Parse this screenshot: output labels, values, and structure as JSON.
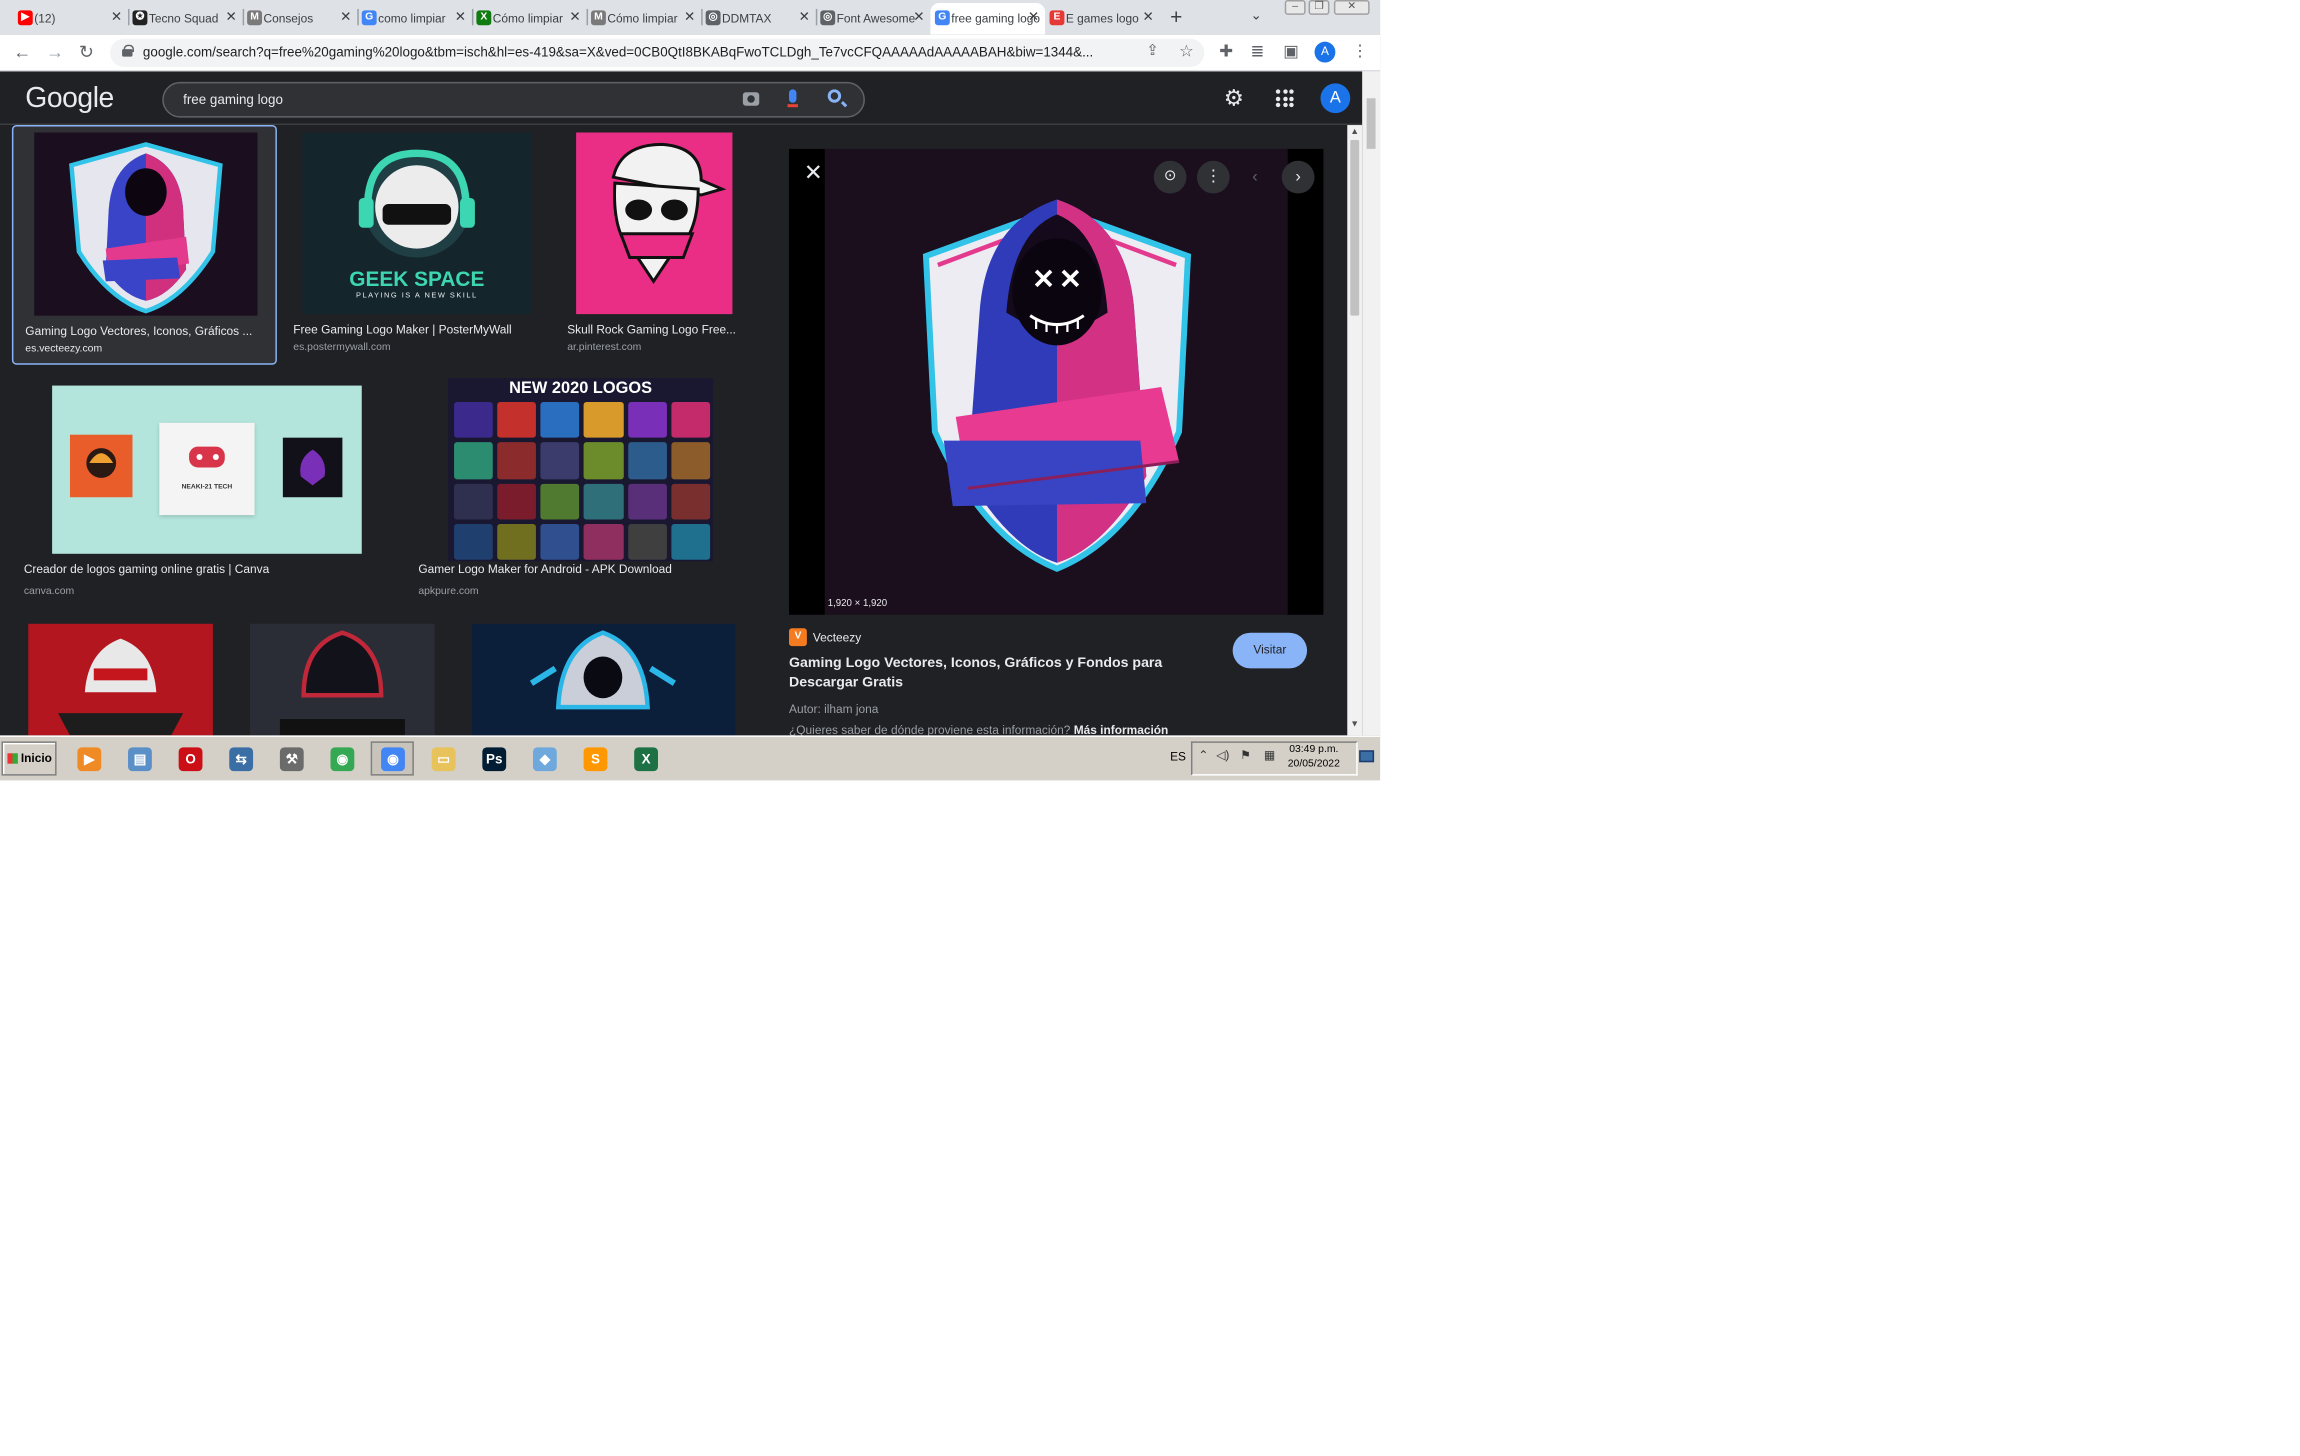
{
  "browser": {
    "tabs": [
      {
        "title": "(12)",
        "favicon": "youtube-icon",
        "color": "#ff0000",
        "glyph": "▶",
        "active": false
      },
      {
        "title": "Tecno Squad",
        "favicon": "site-icon",
        "color": "#222222",
        "glyph": "✪",
        "active": false
      },
      {
        "title": "Consejos",
        "favicon": "mc-icon",
        "color": "#7a7a7a",
        "glyph": "M",
        "active": false
      },
      {
        "title": "como limpiar",
        "favicon": "google-icon",
        "color": "#4285f4",
        "glyph": "G",
        "active": false
      },
      {
        "title": "Cómo limpiar",
        "favicon": "xbox-icon",
        "color": "#107c10",
        "glyph": "X",
        "active": false
      },
      {
        "title": "Cómo limpiar",
        "favicon": "mc-icon",
        "color": "#7a7a7a",
        "glyph": "M",
        "active": false
      },
      {
        "title": "DDMTAX",
        "favicon": "globe-icon",
        "color": "#5f6368",
        "glyph": "◎",
        "active": false
      },
      {
        "title": "Font Awesome",
        "favicon": "globe-icon",
        "color": "#5f6368",
        "glyph": "◎",
        "active": false
      },
      {
        "title": "free gaming logo",
        "favicon": "google-icon",
        "color": "#4285f4",
        "glyph": "G",
        "active": true
      },
      {
        "title": "E games logo",
        "favicon": "site-icon",
        "color": "#e53935",
        "glyph": "E",
        "active": false
      }
    ],
    "url": "google.com/search?q=free%20gaming%20logo&tbm=isch&hl=es-419&sa=X&ved=0CB0QtI8BKABqFwoTCLDgh_Te7vcCFQAAAAAdAAAAABAH&biw=1344&...",
    "profile_initial": "A"
  },
  "google": {
    "logo": "Google",
    "query": "free gaming logo",
    "avatar": "A"
  },
  "results": [
    {
      "caption": "Gaming Logo Vectores, Iconos, Gráficos ...",
      "source": "es.vecteezy.com",
      "selected": true
    },
    {
      "caption": "Free Gaming Logo Maker | PosterMyWall",
      "source": "es.postermywall.com",
      "thumb_title": "GEEK SPACE",
      "thumb_sub": "PLAYING IS A NEW SKILL"
    },
    {
      "caption": "Skull Rock Gaming Logo Free...",
      "source": "ar.pinterest.com"
    },
    {
      "caption": "Creador de logos gaming online gratis | Canva",
      "source": "canva.com",
      "thumb_tiles": [
        "",
        "NEAKI-21 TECH",
        ""
      ]
    },
    {
      "caption": "Gamer Logo Maker for Android - APK Download",
      "source": "apkpure.com",
      "thumb_title": "NEW 2020 LOGOS"
    }
  ],
  "preview": {
    "dimensions": "1,920 × 1,920",
    "site_name": "Vecteezy",
    "title": "Gaming Logo Vectores, Iconos, Gráficos y Fondos para Descargar Gratis",
    "visit_label": "Visitar",
    "author": "Autor: ilham jona",
    "question": "¿Quieres saber de dónde proviene esta información?",
    "more_info": "Más información"
  },
  "taskbar": {
    "start_label": "Inicio",
    "apps": [
      {
        "name": "media-player-icon",
        "color": "#f08a24",
        "glyph": "▶"
      },
      {
        "name": "window-icon",
        "color": "#5b8fc7",
        "glyph": "▤"
      },
      {
        "name": "opera-icon",
        "color": "#cc0f16",
        "glyph": "O"
      },
      {
        "name": "network-icon",
        "color": "#3a6ea5",
        "glyph": "⇆"
      },
      {
        "name": "tools-icon",
        "color": "#6b6b6b",
        "glyph": "⚒"
      },
      {
        "name": "chrome-icon",
        "color": "#34a853",
        "glyph": "◉"
      },
      {
        "name": "chrome-profile-icon",
        "color": "#4285f4",
        "glyph": "◉"
      },
      {
        "name": "folder-icon",
        "color": "#e8c25a",
        "glyph": "▭"
      },
      {
        "name": "photoshop-icon",
        "color": "#001d34",
        "glyph": "Ps"
      },
      {
        "name": "app-icon",
        "color": "#6fa8dc",
        "glyph": "◆"
      },
      {
        "name": "sublime-icon",
        "color": "#ff9800",
        "glyph": "S"
      },
      {
        "name": "excel-icon",
        "color": "#1e7145",
        "glyph": "X"
      }
    ],
    "language": "ES",
    "time": "03:49 p.m.",
    "date": "20/05/2022"
  }
}
